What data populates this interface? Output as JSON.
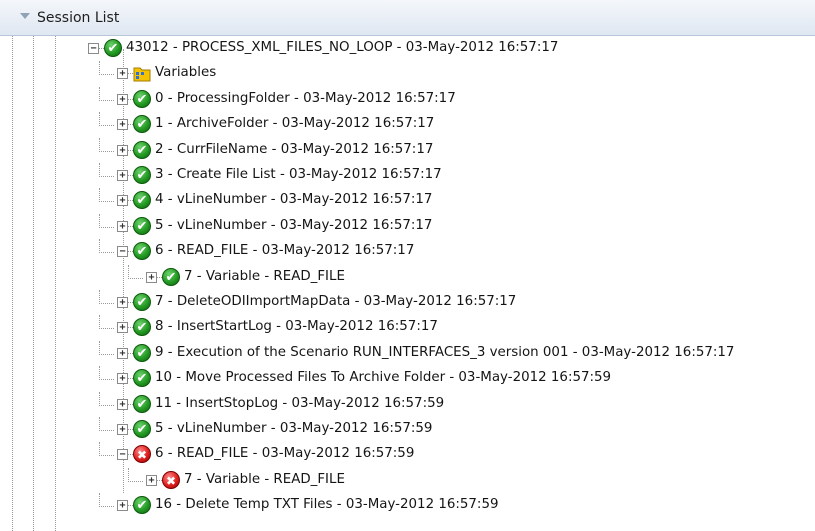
{
  "panel": {
    "title": "Session List",
    "collapse_icon": "triangle-down-icon"
  },
  "tree": {
    "root": {
      "label": "43012 - PROCESS_XML_FILES_NO_LOOP - 03-May-2012 16:57:17",
      "status": "success",
      "expanded": true
    },
    "children": [
      {
        "label": "Variables",
        "icon": "variables-folder-icon",
        "expanded": false
      },
      {
        "label": "0 - ProcessingFolder - 03-May-2012 16:57:17",
        "status": "success",
        "expanded": false
      },
      {
        "label": "1 - ArchiveFolder - 03-May-2012 16:57:17",
        "status": "success",
        "expanded": false
      },
      {
        "label": "2 - CurrFileName - 03-May-2012 16:57:17",
        "status": "success",
        "expanded": false
      },
      {
        "label": "3 - Create File List - 03-May-2012 16:57:17",
        "status": "success",
        "expanded": false
      },
      {
        "label": "4 - vLineNumber - 03-May-2012 16:57:17",
        "status": "success",
        "expanded": false
      },
      {
        "label": "5 - vLineNumber - 03-May-2012 16:57:17",
        "status": "success",
        "expanded": false
      },
      {
        "label": "6 - READ_FILE - 03-May-2012 16:57:17",
        "status": "success",
        "expanded": true,
        "children": [
          {
            "label": "7 - Variable - READ_FILE",
            "status": "success",
            "expanded": false
          }
        ]
      },
      {
        "label": "7 - DeleteODIImportMapData - 03-May-2012 16:57:17",
        "status": "success",
        "expanded": false
      },
      {
        "label": "8 - InsertStartLog - 03-May-2012 16:57:17",
        "status": "success",
        "expanded": false
      },
      {
        "label": "9 - Execution of the Scenario RUN_INTERFACES_3 version 001 - 03-May-2012 16:57:17",
        "status": "success",
        "expanded": false
      },
      {
        "label": "10 - Move Processed Files To Archive Folder - 03-May-2012 16:57:59",
        "status": "success",
        "expanded": false
      },
      {
        "label": "11 - InsertStopLog - 03-May-2012 16:57:59",
        "status": "success",
        "expanded": false
      },
      {
        "label": "5 - vLineNumber - 03-May-2012 16:57:59",
        "status": "success",
        "expanded": false
      },
      {
        "label": "6 - READ_FILE - 03-May-2012 16:57:59",
        "status": "error",
        "expanded": true,
        "children": [
          {
            "label": "7 - Variable - READ_FILE",
            "status": "error",
            "expanded": false
          }
        ]
      },
      {
        "label": "16 - Delete Temp TXT Files - 03-May-2012 16:57:59",
        "status": "success",
        "expanded": false
      }
    ]
  },
  "colors": {
    "success": "#249a24",
    "error": "#e02020",
    "header_bg": "#dfe7f1",
    "guide": "#9a9a9a"
  }
}
